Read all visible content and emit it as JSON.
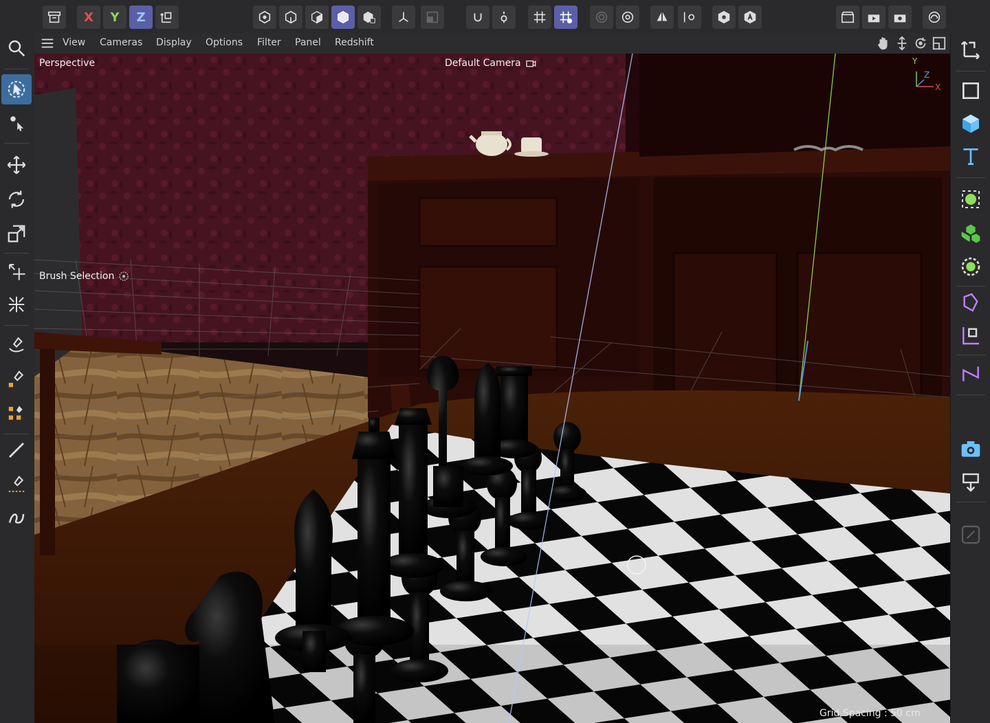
{
  "colors": {
    "accent": "#5a5fa8",
    "active_tool": "#3d6d9e",
    "axis_x": "#e05252",
    "axis_y": "#8bd35a",
    "axis_z": "#5aa0e0"
  },
  "toolbar": {
    "axis_x": "X",
    "axis_y": "Y",
    "axis_z": "Z"
  },
  "menu": {
    "items": [
      "View",
      "Cameras",
      "Display",
      "Options",
      "Filter",
      "Panel",
      "Redshift"
    ]
  },
  "viewport": {
    "view_name": "Perspective",
    "camera_name": "Default Camera",
    "tool_name": "Brush Selection",
    "grid_spacing": "Grid Spacing : 50 cm",
    "axis_labels": {
      "y": "Y",
      "z": "Z",
      "x": "X"
    }
  },
  "left_tools": [
    "search-icon",
    "live-selection-icon",
    "selection-settings-icon",
    "move-icon",
    "rotate-icon",
    "scale-icon",
    "transform-move-icon",
    "transform-scale-icon",
    "brush-select-icon",
    "paint-icon",
    "multi-paint-icon",
    "brush-icon",
    "line-select-icon",
    "spline-icon"
  ],
  "right_tools": [
    "coordinate-icon",
    "rectangle-icon",
    "cube-icon",
    "text-icon",
    "generator-icon",
    "mograph-icon",
    "effector-icon",
    "deformer-icon",
    "field-icon",
    "spline-tool-icon",
    "light-icon",
    "camera-icon",
    "render-icon",
    "disabled-icon"
  ]
}
